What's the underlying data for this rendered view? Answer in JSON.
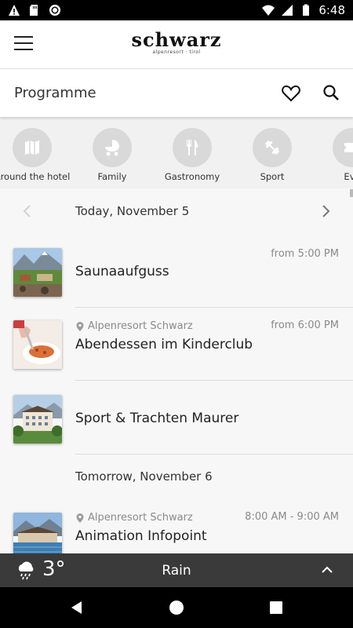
{
  "status_bar": {
    "time": "6:48"
  },
  "app": {
    "brand": "schwarz",
    "brand_sub": "alpenresort · tirol"
  },
  "page": {
    "title": "Programme"
  },
  "categories": [
    {
      "label": "Around the hotel",
      "icon": "map-icon"
    },
    {
      "label": "Family",
      "icon": "stroller-icon"
    },
    {
      "label": "Gastronomy",
      "icon": "cutlery-icon"
    },
    {
      "label": "Sport",
      "icon": "dumbbell-icon"
    },
    {
      "label": "Eve",
      "icon": "ticket-icon"
    }
  ],
  "today_label": "Today, November 5",
  "tomorrow_label": "Tomorrow, November 6",
  "events": [
    {
      "name": "Saunaaufguss",
      "location": "",
      "time": "from 5:00 PM",
      "thumb": "alpine-landscape"
    },
    {
      "name": "Abendessen im Kinderclub",
      "location": "Alpenresort Schwarz",
      "time": "from 6:00 PM",
      "thumb": "pasta-dinner"
    },
    {
      "name": "Sport & Trachten Maurer",
      "location": "",
      "time": "",
      "thumb": "hotel-building"
    },
    {
      "name": "Animation Infopoint",
      "location": "Alpenresort Schwarz",
      "time": "8:00 AM - 9:00 AM",
      "thumb": "resort-lake"
    }
  ],
  "weather": {
    "temp": "3°",
    "condition": "Rain",
    "icon": "rain-cloud-icon"
  },
  "colors": {
    "accent_bar": "#3a3a3a",
    "muted_text": "#8a8a8a",
    "category_circle": "#d9d9d9"
  }
}
